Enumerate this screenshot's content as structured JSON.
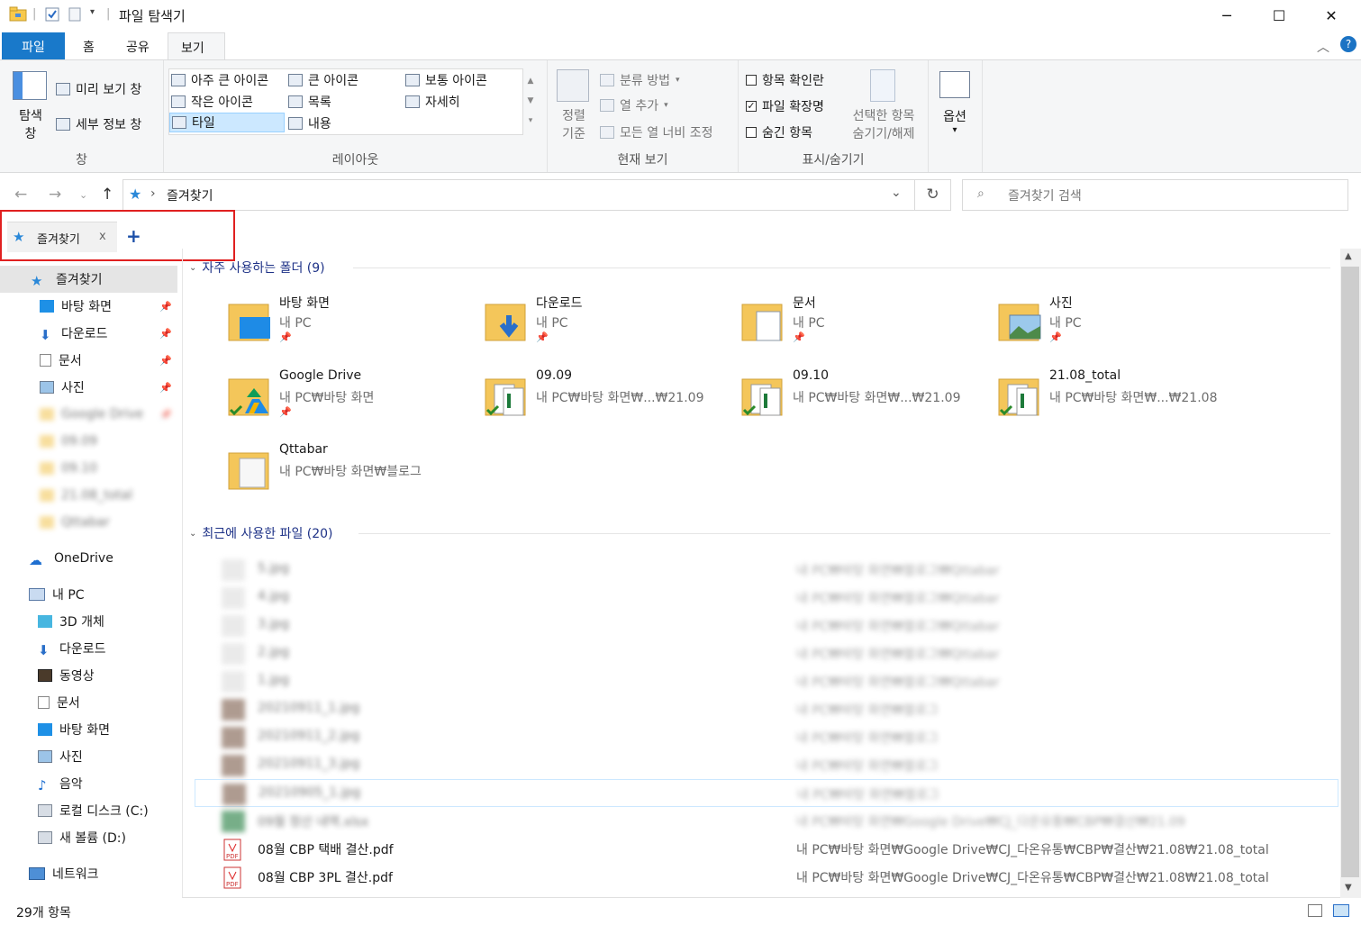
{
  "window": {
    "title": "파일 탐색기",
    "controls": {
      "minimize": "─",
      "maximize": "☐",
      "close": "✕"
    }
  },
  "ribbon_tabs": [
    "파일",
    "홈",
    "공유",
    "보기"
  ],
  "ribbon": {
    "pane_group": {
      "nav_pane": "탐색\n창",
      "preview_pane": "미리 보기 창",
      "details_pane": "세부 정보 창",
      "label": "창"
    },
    "layout_group": {
      "items": [
        "아주 큰 아이콘",
        "큰 아이콘",
        "보통 아이콘",
        "작은 아이콘",
        "목록",
        "자세히",
        "타일",
        "내용"
      ],
      "label": "레이아웃"
    },
    "current_view_group": {
      "sort": "정렬\n기준",
      "group_by": "분류 방법",
      "add_column": "열 추가",
      "fit_columns": "모든 열 너비 조정",
      "label": "현재 보기"
    },
    "show_hide_group": {
      "item_checkboxes": "항목 확인란",
      "file_extensions": "파일 확장명",
      "hidden_items": "숨긴 항목",
      "hide_selected": "선택한 항목\n숨기기/해제",
      "label": "표시/숨기기"
    },
    "options": "옵션"
  },
  "address": {
    "path": "즐겨찾기",
    "search_placeholder": "즐겨찾기 검색"
  },
  "tabbar": {
    "tab_label": "즐겨찾기",
    "close": "x",
    "add": "+"
  },
  "nav_pane": {
    "quick_access": "즐겨찾기",
    "pinned": [
      "바탕 화면",
      "다운로드",
      "문서",
      "사진"
    ],
    "blurred": [
      "Google Drive",
      "09.09",
      "09.10",
      "21.08_total",
      "Qttabar"
    ],
    "onedrive": "OneDrive",
    "this_pc": "내 PC",
    "pc_items": [
      "3D 개체",
      "다운로드",
      "동영상",
      "문서",
      "바탕 화면",
      "사진",
      "음악",
      "로컬 디스크 (C:)",
      "새 볼륨 (D:)"
    ],
    "network": "네트워크"
  },
  "frequent": {
    "header": "자주 사용하는 폴더 (9)",
    "tiles": [
      {
        "name": "바탕 화면",
        "loc": "내 PC"
      },
      {
        "name": "다운로드",
        "loc": "내 PC"
      },
      {
        "name": "문서",
        "loc": "내 PC"
      },
      {
        "name": "사진",
        "loc": "내 PC"
      },
      {
        "name": "Google Drive",
        "loc": "내 PC₩바탕 화면"
      },
      {
        "name": "09.09",
        "loc": "내 PC₩바탕 화면₩...₩21.09"
      },
      {
        "name": "09.10",
        "loc": "내 PC₩바탕 화면₩...₩21.09"
      },
      {
        "name": "21.08_total",
        "loc": "내 PC₩바탕 화면₩...₩21.08"
      },
      {
        "name": "Qttabar",
        "loc": "내 PC₩바탕 화면₩블로그"
      }
    ]
  },
  "recent": {
    "header": "최근에 사용한 파일 (20)",
    "files": [
      {
        "name": "5.jpg",
        "path": "내 PC₩바탕 화면₩블로그₩Qttabar"
      },
      {
        "name": "4.jpg",
        "path": "내 PC₩바탕 화면₩블로그₩Qttabar"
      },
      {
        "name": "3.jpg",
        "path": "내 PC₩바탕 화면₩블로그₩Qttabar"
      },
      {
        "name": "2.jpg",
        "path": "내 PC₩바탕 화면₩블로그₩Qttabar"
      },
      {
        "name": "1.jpg",
        "path": "내 PC₩바탕 화면₩블로그₩Qttabar"
      },
      {
        "name": "20210911_1.jpg",
        "path": "내 PC₩바탕 화면₩블로그"
      },
      {
        "name": "20210911_2.jpg",
        "path": "내 PC₩바탕 화면₩블로그"
      },
      {
        "name": "20210911_3.jpg",
        "path": "내 PC₩바탕 화면₩블로그"
      },
      {
        "name": "20210905_1.jpg",
        "path": "내 PC₩바탕 화면₩블로그"
      },
      {
        "name": "09월 정산 내역.xlsx",
        "path": "내 PC₩바탕 화면₩Google Drive₩CJ_다온유통₩CBP₩결산₩21.09"
      },
      {
        "name": "08월 CBP 택배 결산.pdf",
        "path": "내 PC₩바탕 화면₩Google Drive₩CJ_다온유통₩CBP₩결산₩21.08₩21.08_total"
      },
      {
        "name": "08월 CBP 3PL 결산.pdf",
        "path": "내 PC₩바탕 화면₩Google Drive₩CJ_다온유통₩CBP₩결산₩21.08₩21.08_total"
      }
    ]
  },
  "status": {
    "count": "29개 항목"
  }
}
